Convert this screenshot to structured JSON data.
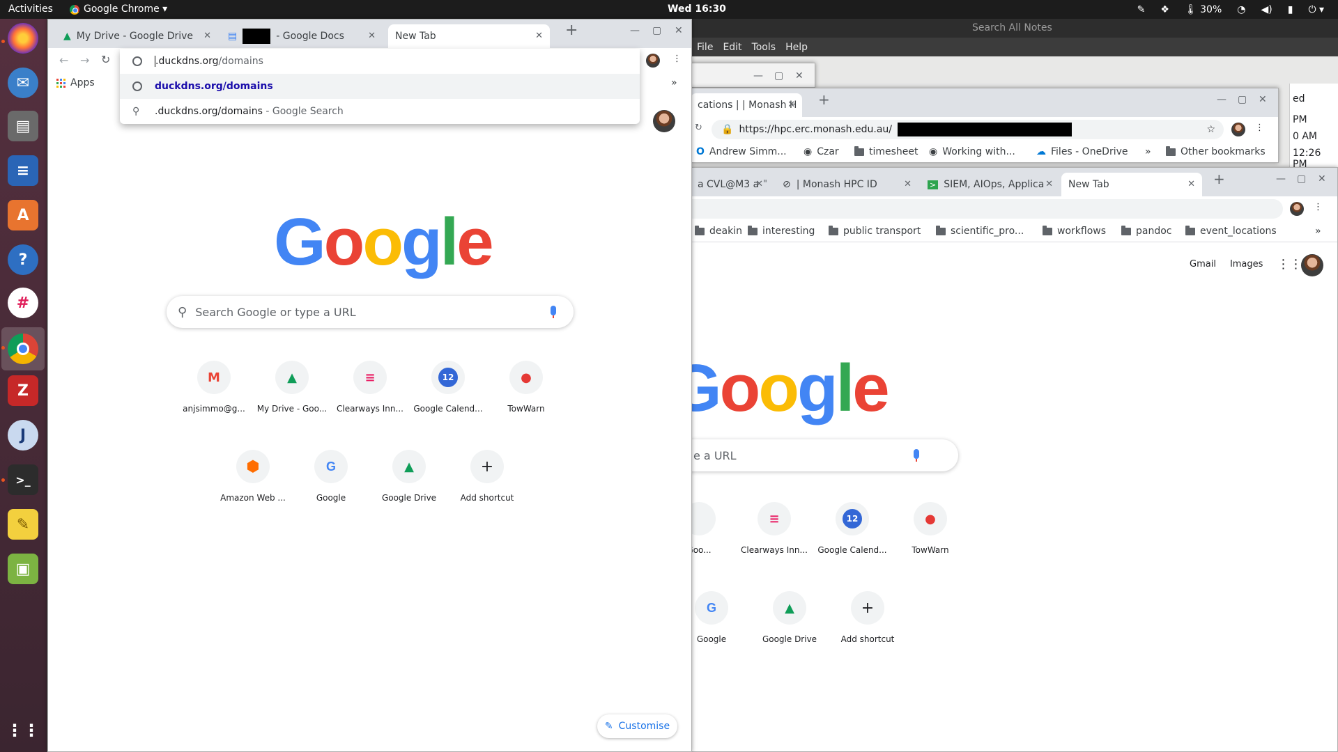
{
  "topbar": {
    "activities": "Activities",
    "app_name": "Google Chrome ▾",
    "clock": "Wed 16:30",
    "battery": "30%"
  },
  "notes": {
    "search_placeholder": "Search All Notes",
    "menu": [
      "File",
      "Edit",
      "Tools",
      "Help"
    ],
    "list_fragments": [
      "ed",
      "PM",
      "0 AM",
      "12:26 PM"
    ]
  },
  "front_window": {
    "tabs": [
      {
        "label": "My Drive - Google Drive"
      },
      {
        "label": "- Google Docs"
      },
      {
        "label": "New Tab"
      }
    ],
    "address": {
      "typed": ".duckdns.org",
      "suggested": "/domains"
    },
    "bookmarks": {
      "apps": "Apps"
    },
    "omnibox": {
      "suggestion_url": "duckdns.org/domains",
      "suggestion_search": ".duckdns.org/domains",
      "suggestion_search_suffix": " - Google Search"
    },
    "search_placeholder": "Search Google or type a URL",
    "tiles": [
      {
        "label": "anjsimmo@g...",
        "icon": "gmail-icon",
        "glyph": "M"
      },
      {
        "label": "My Drive - Goo...",
        "icon": "google-drive-icon",
        "glyph": "▲"
      },
      {
        "label": "Clearways Inn...",
        "icon": "clearways-icon",
        "glyph": "≡"
      },
      {
        "label": "Google Calend...",
        "icon": "google-calendar-icon",
        "glyph": "12"
      },
      {
        "label": "TowWarn",
        "icon": "towwarn-icon",
        "glyph": "●"
      },
      {
        "label": "Amazon Web ...",
        "icon": "aws-icon",
        "glyph": "⬢"
      },
      {
        "label": "Google",
        "icon": "google-g-icon",
        "glyph": "G"
      },
      {
        "label": "Google Drive",
        "icon": "google-drive-icon",
        "glyph": "▲"
      },
      {
        "label": "Add shortcut",
        "icon": "add-icon",
        "glyph": "+"
      }
    ],
    "customise": "Customise"
  },
  "monash_window": {
    "tab_label": "cations | | Monash H",
    "url": "https://hpc.erc.monash.edu.au/",
    "bookmarks": [
      "Andrew Simm...",
      "Czar",
      "timesheet",
      "Working with...",
      "Files - OneDrive",
      "»",
      "Other bookmarks"
    ]
  },
  "right_window": {
    "tabs": [
      {
        "label": "a CVL@M3 a"
      },
      {
        "label": "| Monash HPC ID"
      },
      {
        "label": "SIEM, AIOps, Applica"
      },
      {
        "label": "New Tab"
      }
    ],
    "bookmarks": [
      "deakin",
      "interesting",
      "public transport",
      "scientific_pro...",
      "workflows",
      "pandoc",
      "event_locations",
      "»"
    ],
    "gmail": "Gmail",
    "images": "Images",
    "search_fragment": "e a URL",
    "tiles": [
      {
        "label": "Goo...",
        "glyph": "",
        "icon": "blank-icon"
      },
      {
        "label": "Clearways Inn...",
        "glyph": "≡",
        "icon": "clearways-icon"
      },
      {
        "label": "Google Calend...",
        "glyph": "12",
        "icon": "google-calendar-icon"
      },
      {
        "label": "TowWarn",
        "glyph": "●",
        "icon": "towwarn-icon"
      },
      {
        "label": "Google",
        "glyph": "G",
        "icon": "google-g-icon"
      },
      {
        "label": "Google Drive",
        "glyph": "▲",
        "icon": "google-drive-icon"
      },
      {
        "label": "Add shortcut",
        "glyph": "+",
        "icon": "add-icon"
      }
    ]
  },
  "google_logo": [
    "G",
    "o",
    "o",
    "g",
    "l",
    "e"
  ],
  "colors": {
    "accent": "#1a73e8",
    "dock": "#55303f",
    "ubuntu_orange": "#e95420"
  }
}
